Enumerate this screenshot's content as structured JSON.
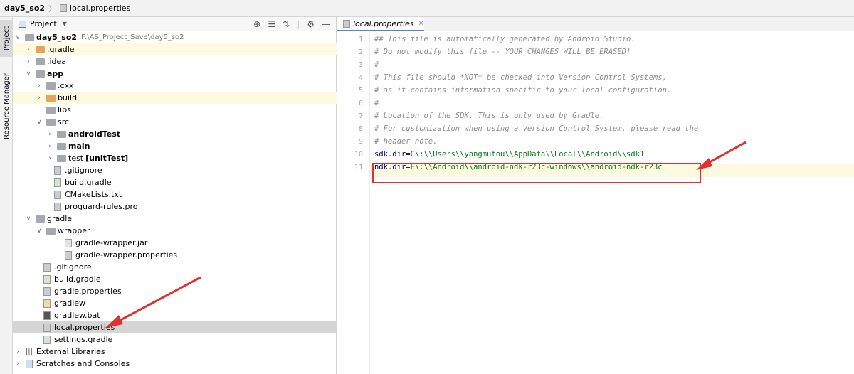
{
  "breadcrumb": {
    "project": "day5_so2",
    "file": "local.properties"
  },
  "strip": {
    "project_tab": "Project",
    "resource_tab": "Resource Manager"
  },
  "panel": {
    "title": "Project"
  },
  "tree": [
    {
      "label": "day5_so2",
      "extra": "F:\\AS_Project_Save\\day5_so2"
    },
    {
      "label": ".gradle"
    },
    {
      "label": ".idea"
    },
    {
      "label": "app"
    },
    {
      "label": ".cxx"
    },
    {
      "label": "build"
    },
    {
      "label": "libs"
    },
    {
      "label": "src"
    },
    {
      "label": "androidTest"
    },
    {
      "label": "main"
    },
    {
      "label": "test",
      "extra": "[unitTest]"
    },
    {
      "label": ".gitignore"
    },
    {
      "label": "build.gradle"
    },
    {
      "label": "CMakeLists.txt"
    },
    {
      "label": "proguard-rules.pro"
    },
    {
      "label": "gradle"
    },
    {
      "label": "wrapper"
    },
    {
      "label": "gradle-wrapper.jar"
    },
    {
      "label": "gradle-wrapper.properties"
    },
    {
      "label": ".gitignore"
    },
    {
      "label": "build.gradle"
    },
    {
      "label": "gradle.properties"
    },
    {
      "label": "gradlew"
    },
    {
      "label": "gradlew.bat"
    },
    {
      "label": "local.properties"
    },
    {
      "label": "settings.gradle"
    },
    {
      "label": "External Libraries"
    },
    {
      "label": "Scratches and Consoles"
    }
  ],
  "editor": {
    "tab": "local.properties",
    "lines": [
      "## This file is automatically generated by Android Studio.",
      "# Do not modify this file -- YOUR CHANGES WILL BE ERASED!",
      "#",
      "# This file should *NOT* be checked into Version Control Systems,",
      "# as it contains information specific to your local configuration.",
      "#",
      "# Location of the SDK. This is only used by Gradle.",
      "# For customization when using a Version Control System, please read the",
      "# header note."
    ],
    "sdk": {
      "key": "sdk.dir",
      "eq": "=",
      "value": "C\\:\\\\Users\\\\yangmutou\\\\AppData\\\\Local\\\\Android\\\\sdk1"
    },
    "ndk": {
      "key": "ndk.dir",
      "eq": "=",
      "value": "E\\:\\\\Android\\\\android-ndk-r23c-windows\\\\android-ndk-r23c"
    },
    "line_numbers": [
      "1",
      "2",
      "3",
      "4",
      "5",
      "6",
      "7",
      "8",
      "9",
      "10",
      "11"
    ]
  },
  "colors": {
    "annotation": "#e03030",
    "string": "#067d17",
    "key": "#000080",
    "comment": "#8c8c8c"
  }
}
